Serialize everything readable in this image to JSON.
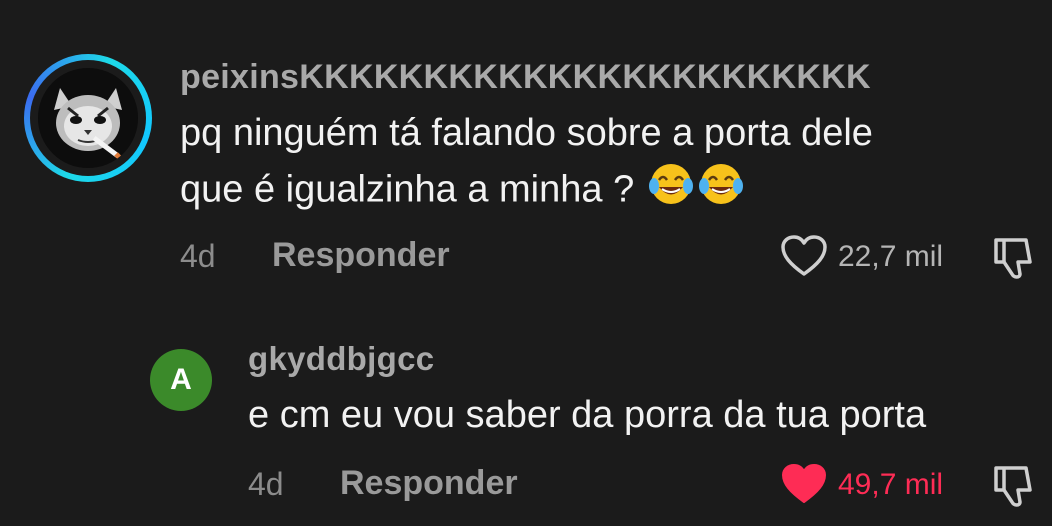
{
  "comment": {
    "username": "peixinsKKKKKKKKKKKKKKKKKKKKKKK",
    "text_line1": "pq ninguém tá falando sobre a porta dele",
    "text_line2": "que é igualzinha a minha ?",
    "emoji": "😂😂",
    "time": "4d",
    "reply_label": "Responder",
    "likes": "22,7 mil",
    "liked": false
  },
  "reply": {
    "avatar_letter": "A",
    "username": "gkyddbjgcc",
    "text": "e cm eu vou saber da porra da tua porta",
    "time": "4d",
    "reply_label": "Responder",
    "likes": "49,7 mil",
    "liked": true
  },
  "colors": {
    "background": "#1b1b1b",
    "liked_red": "#fe2c55",
    "avatar_green": "#3b8a2a",
    "ring_cyan": "#1ed9e8"
  },
  "icons": [
    "heart-outline-icon",
    "heart-filled-icon",
    "dislike-icon"
  ]
}
